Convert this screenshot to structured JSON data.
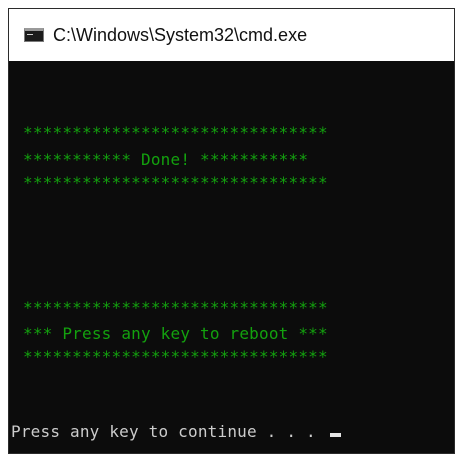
{
  "window": {
    "title": "C:\\Windows\\System32\\cmd.exe",
    "icon": "cmd-icon"
  },
  "console": {
    "lines": [
      "*******************************",
      "*********** Done! ***********",
      "*******************************",
      "*******************************",
      "*** Press any key to reboot ***",
      "*******************************",
      "Press any key to continue . . . "
    ]
  },
  "colors": {
    "console_bg": "#0c0c0c",
    "green_text": "#13a10e",
    "white_text": "#cccccc"
  }
}
